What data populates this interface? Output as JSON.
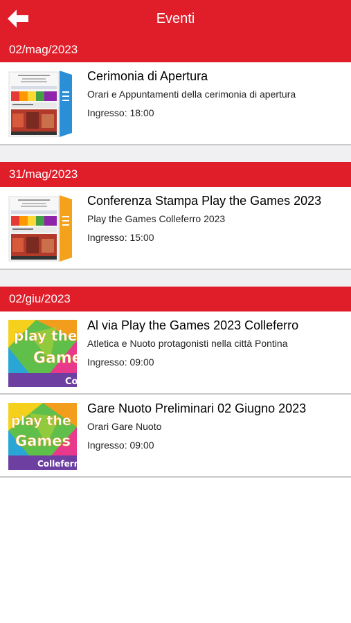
{
  "header": {
    "title": "Eventi",
    "back_icon": "arrow-left-icon"
  },
  "sections": [
    {
      "date": "02/mag/2023",
      "events": [
        {
          "title": "Cerimonia di Apertura",
          "subtitle": "Orari e Appuntamenti della cerimonia di apertura",
          "entry_label": "Ingresso:",
          "entry_time": "18:00",
          "thumb_type": "flyer-blue"
        }
      ]
    },
    {
      "date": "31/mag/2023",
      "events": [
        {
          "title": "Conferenza Stampa Play the Games 2023",
          "subtitle": "Play the Games Colleferro 2023",
          "entry_label": "Ingresso:",
          "entry_time": "15:00",
          "thumb_type": "flyer-orange"
        }
      ]
    },
    {
      "date": "02/giu/2023",
      "events": [
        {
          "title": "Al via Play the Games 2023 Colleferro",
          "subtitle": "Atletica e Nuoto protagonisti nella città Pontina",
          "entry_label": "Ingresso:",
          "entry_time": "09:00",
          "thumb_type": "logo-cropped"
        },
        {
          "title": "Gare Nuoto Preliminari 02 Giugno 2023",
          "subtitle": "Orari Gare Nuoto",
          "entry_label": "Ingresso:",
          "entry_time": "09:00",
          "thumb_type": "logo-full"
        }
      ]
    }
  ],
  "colors": {
    "accent": "#e01e2a",
    "divider": "#c9c9c9",
    "gap": "#f0f0f2"
  },
  "thumb_text": {
    "play": "play the",
    "games": "Games",
    "city": "Colleferro"
  }
}
